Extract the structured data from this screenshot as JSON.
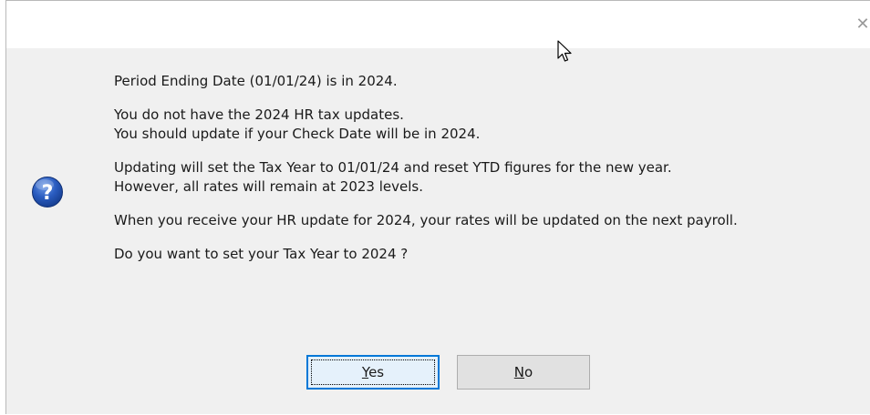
{
  "dialog": {
    "close_icon": "✕",
    "icon": "question-icon",
    "paragraphs": [
      {
        "lines": [
          "Period Ending Date (01/01/24) is in 2024."
        ]
      },
      {
        "lines": [
          "You do not have the 2024 HR tax updates.",
          "You should update if your Check Date will be in 2024."
        ]
      },
      {
        "lines": [
          "Updating will set the Tax Year to 01/01/24 and reset YTD figures for the new year.",
          "However, all rates will remain at 2023 levels."
        ]
      },
      {
        "lines": [
          "When you receive your HR update for 2024, your rates will be updated on the next payroll."
        ]
      },
      {
        "lines": [
          "Do you want to set your Tax Year to 2024 ?"
        ]
      }
    ],
    "buttons": {
      "yes": {
        "mnemonic": "Y",
        "rest": "es"
      },
      "no": {
        "mnemonic": "N",
        "rest": "o"
      }
    },
    "colors": {
      "accent": "#0078d7",
      "body_bg": "#f0f0f0",
      "icon_blue": "#1f4fa8"
    }
  }
}
